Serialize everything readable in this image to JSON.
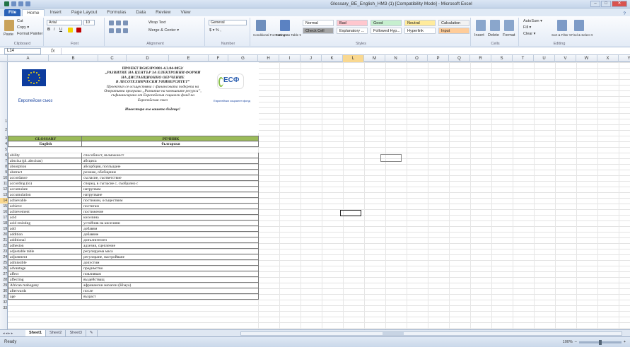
{
  "title": "Glossary_BE_English_HM3 (1) [Compatibility Mode] - Microsoft Excel",
  "window_buttons": [
    "–",
    "□",
    "✕"
  ],
  "tabs": [
    "File",
    "Home",
    "Insert",
    "Page Layout",
    "Formulas",
    "Data",
    "Review",
    "View"
  ],
  "ribbon": {
    "clipboard": {
      "paste": "Paste",
      "cut": "Cut",
      "copy": "Copy ▾",
      "painter": "Format Painter",
      "label": "Clipboard"
    },
    "font": {
      "name": "Arial",
      "size": "10",
      "label": "Font"
    },
    "alignment": {
      "wrap": "Wrap Text",
      "merge": "Merge & Center ▾",
      "label": "Alignment"
    },
    "number": {
      "format": "General",
      "label": "Number"
    },
    "styles": {
      "cond": "Conditional Formatting ▾",
      "table": "Format as Table ▾",
      "cells": [
        {
          "label": "Normal",
          "color": "#ffffff"
        },
        {
          "label": "Bad",
          "color": "#ffc7ce"
        },
        {
          "label": "Good",
          "color": "#c6efce"
        },
        {
          "label": "Neutral",
          "color": "#ffeb9c"
        },
        {
          "label": "Calculation",
          "color": "#f2f2f2"
        },
        {
          "label": "Check Cell",
          "color": "#a5a5a5"
        },
        {
          "label": "Explanatory ...",
          "color": "#ffffff"
        },
        {
          "label": "Followed Hyp...",
          "color": "#ffffff"
        },
        {
          "label": "Hyperlink",
          "color": "#ffffff"
        },
        {
          "label": "Input",
          "color": "#ffcc99"
        }
      ],
      "label": "Styles"
    },
    "cells": {
      "insert": "Insert",
      "delete": "Delete",
      "format": "Format",
      "label": "Cells"
    },
    "editing": {
      "autosum": "AutoSum ▾",
      "fill": "Fill ▾",
      "clear": "Clear ▾",
      "sort": "Sort & Filter ▾",
      "find": "Find & Select ▾",
      "label": "Editing"
    }
  },
  "namebox": "L14",
  "fx": "fx",
  "columns": [
    "A",
    "B",
    "C",
    "D",
    "E",
    "F",
    "G",
    "H",
    "I",
    "J",
    "K",
    "L",
    "M",
    "N",
    "O",
    "P",
    "Q",
    "R",
    "S",
    "T",
    "U",
    "V",
    "W",
    "X",
    "Y"
  ],
  "active_column": "L",
  "header": {
    "eu_caption": "Европейски съюз",
    "lines": [
      {
        "t": "ПРОЕКТ BG051PO001-4.3.04-0052/",
        "s": "b"
      },
      {
        "t": "„РАЗВИТИЕ НА ЦЕНТЪР ЗА ЕЛЕКТРОННИ ФОРМИ",
        "s": "bi"
      },
      {
        "t": "НА ДИСТАНЦИОННО ОБУЧЕНИЕ",
        "s": "bi"
      },
      {
        "t": "В ЛЕСОТЕХНИЧЕСКИ УНИВЕРСИТЕТ”",
        "s": "bi"
      },
      {
        "t": "Проектът се осъществява с финансовата подкрепа на",
        "s": "i"
      },
      {
        "t": "Оперативна програма „Развитие на човешките ресурси”,",
        "s": "i"
      },
      {
        "t": "съфинансирана от Европейския социален фонд на",
        "s": "i"
      },
      {
        "t": "Европейския съюз",
        "s": "i"
      },
      {
        "t": "",
        "s": "i"
      },
      {
        "t": "Инвестира във вашето бъдеще!",
        "s": "bi"
      }
    ],
    "esf_logo": "ЕСФ",
    "esf_caption": "Европейски социален фонд"
  },
  "table": {
    "headers": [
      "GLOSSARY",
      "РЕЧНИК"
    ],
    "subheaders": [
      "English",
      "български"
    ],
    "rows": [
      [
        "ability",
        "способност, възможност"
      ],
      [
        "abscisa (pl. abscisas)",
        "абсциса"
      ],
      [
        "absorption",
        "абсорбция, поглъщане"
      ],
      [
        "abstract",
        "резюме, обобщение"
      ],
      [
        "accordance",
        "съгласие, съответствие"
      ],
      [
        "according (to)",
        "според, в съгласие с, съобразно с"
      ],
      [
        "accumulate",
        "натрупвам"
      ],
      [
        "accumulation",
        "натрупване"
      ],
      [
        "achievable",
        "постижим, осъществим"
      ],
      [
        "achieve",
        "постигам"
      ],
      [
        "achievement",
        "постижение"
      ],
      [
        "acid",
        "киселина"
      ],
      [
        "acid resisting",
        "устойчив на киселини"
      ],
      [
        "add",
        "добавям"
      ],
      [
        "addition",
        "добавяне"
      ],
      [
        "additional",
        "допълнителен"
      ],
      [
        "adhesion",
        "адхезия, сцепление"
      ],
      [
        "adjustable table",
        "регулируема маса"
      ],
      [
        "adjustment",
        "регулиране, настройване"
      ],
      [
        "admissible",
        "допустим"
      ],
      [
        "advantage",
        "предимство"
      ],
      [
        "affect",
        "повлиявам"
      ],
      [
        "affecting",
        "въздействащ"
      ],
      [
        "African mahogany",
        "африкански махагон (Khaya)"
      ],
      [
        "afterwards",
        "после"
      ],
      [
        "age",
        "възраст"
      ]
    ]
  },
  "row_numbers": [
    "1",
    "2",
    "3",
    "4",
    "5",
    "6",
    "7",
    "8",
    "9",
    "10",
    "11",
    "12",
    "13",
    "14",
    "15",
    "16",
    "17",
    "18",
    "19",
    "20",
    "21",
    "22",
    "23",
    "24",
    "25",
    "26",
    "27",
    "28",
    "29",
    "30",
    "31",
    "32",
    "33"
  ],
  "active_row": "14",
  "sheets": [
    "Sheet1",
    "Sheet2",
    "Sheet3"
  ],
  "sheet_nav": "◂ ◂ ▸ ▸",
  "status": "Ready",
  "zoom": "100%"
}
